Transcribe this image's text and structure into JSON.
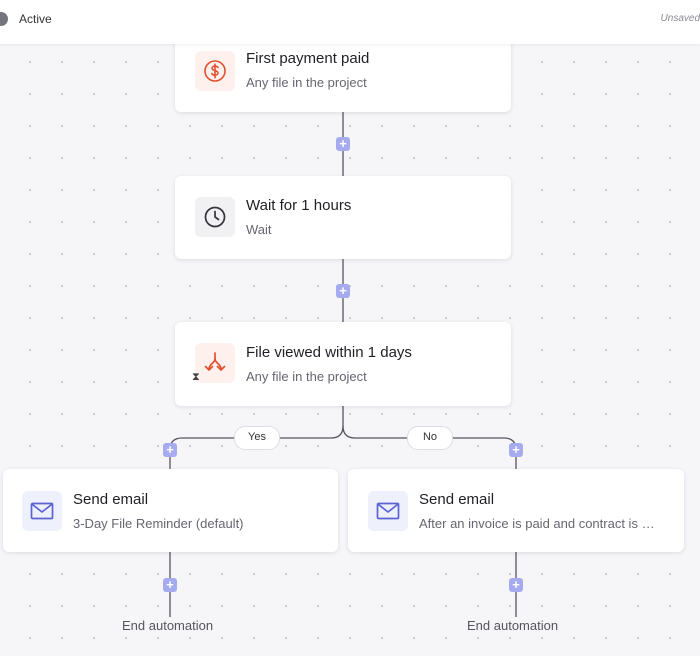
{
  "header": {
    "status": "Active",
    "save_status": "Unsaved"
  },
  "steps": [
    {
      "title": "First payment paid",
      "subtitle": "Any file in the project",
      "icon": "dollar-circle-icon"
    },
    {
      "title": "Wait for 1 hours",
      "subtitle": "Wait",
      "icon": "clock-icon"
    },
    {
      "title": "File viewed within 1 days",
      "subtitle": "Any file in the project",
      "icon": "branch-arrows-icon",
      "badge_icon": "hourglass-icon"
    }
  ],
  "branches": [
    {
      "label": "Yes",
      "action_title": "Send email",
      "action_subtitle": "3-Day File Reminder (default)",
      "icon": "envelope-icon",
      "end_label": "End automation"
    },
    {
      "label": "No",
      "action_title": "Send email",
      "action_subtitle": "After an invoice is paid and contract is signed",
      "icon": "envelope-icon",
      "end_label": "End automation"
    }
  ],
  "add_button_symbol": "+",
  "colors": {
    "accent": "#a6aaee",
    "trigger_icon": "#e0502e",
    "email_icon": "#5b63d3"
  }
}
